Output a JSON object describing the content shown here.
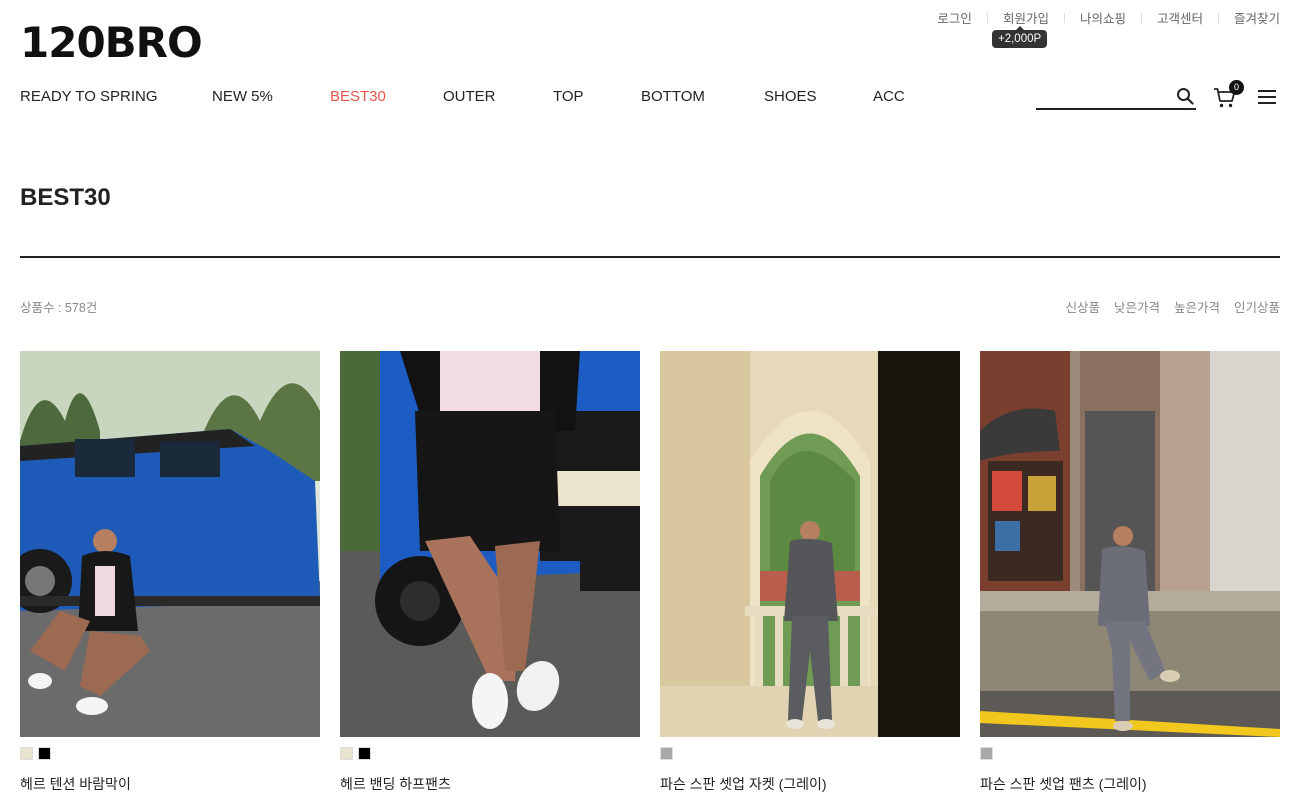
{
  "brand": {
    "logo": "120BRO"
  },
  "top_links": [
    "로그인",
    "회원가입",
    "나의쇼핑",
    "고객센터",
    "즐겨찾기"
  ],
  "signup_tip": "+2,000P",
  "nav": [
    {
      "label": "READY TO SPRING",
      "active": false
    },
    {
      "label": "NEW 5%",
      "active": false
    },
    {
      "label": "BEST30",
      "active": true
    },
    {
      "label": "OUTER",
      "active": false
    },
    {
      "label": "TOP",
      "active": false
    },
    {
      "label": "BOTTOM",
      "active": false
    },
    {
      "label": "SHOES",
      "active": false
    },
    {
      "label": "ACC",
      "active": false
    }
  ],
  "search": {
    "value": "",
    "placeholder": ""
  },
  "cart": {
    "count": "0"
  },
  "page": {
    "title": "BEST30",
    "count_text": "상품수 : 578건"
  },
  "sort_options": [
    "신상품",
    "낮은가격",
    "높은가격",
    "인기상품"
  ],
  "accent_color": "#e8554e",
  "products": [
    {
      "name": "헤르 텐션 바람막이",
      "colors": [
        "#e9e4d0",
        "#000000"
      ]
    },
    {
      "name": "헤르 밴딩 하프팬츠",
      "colors": [
        "#e9e4d0",
        "#000000"
      ]
    },
    {
      "name": "파슨 스판 셋업 자켓 (그레이)",
      "colors": [
        "#a9a9a9"
      ]
    },
    {
      "name": "파슨 스판 셋업 팬츠 (그레이)",
      "colors": [
        "#a9a9a9"
      ]
    }
  ]
}
